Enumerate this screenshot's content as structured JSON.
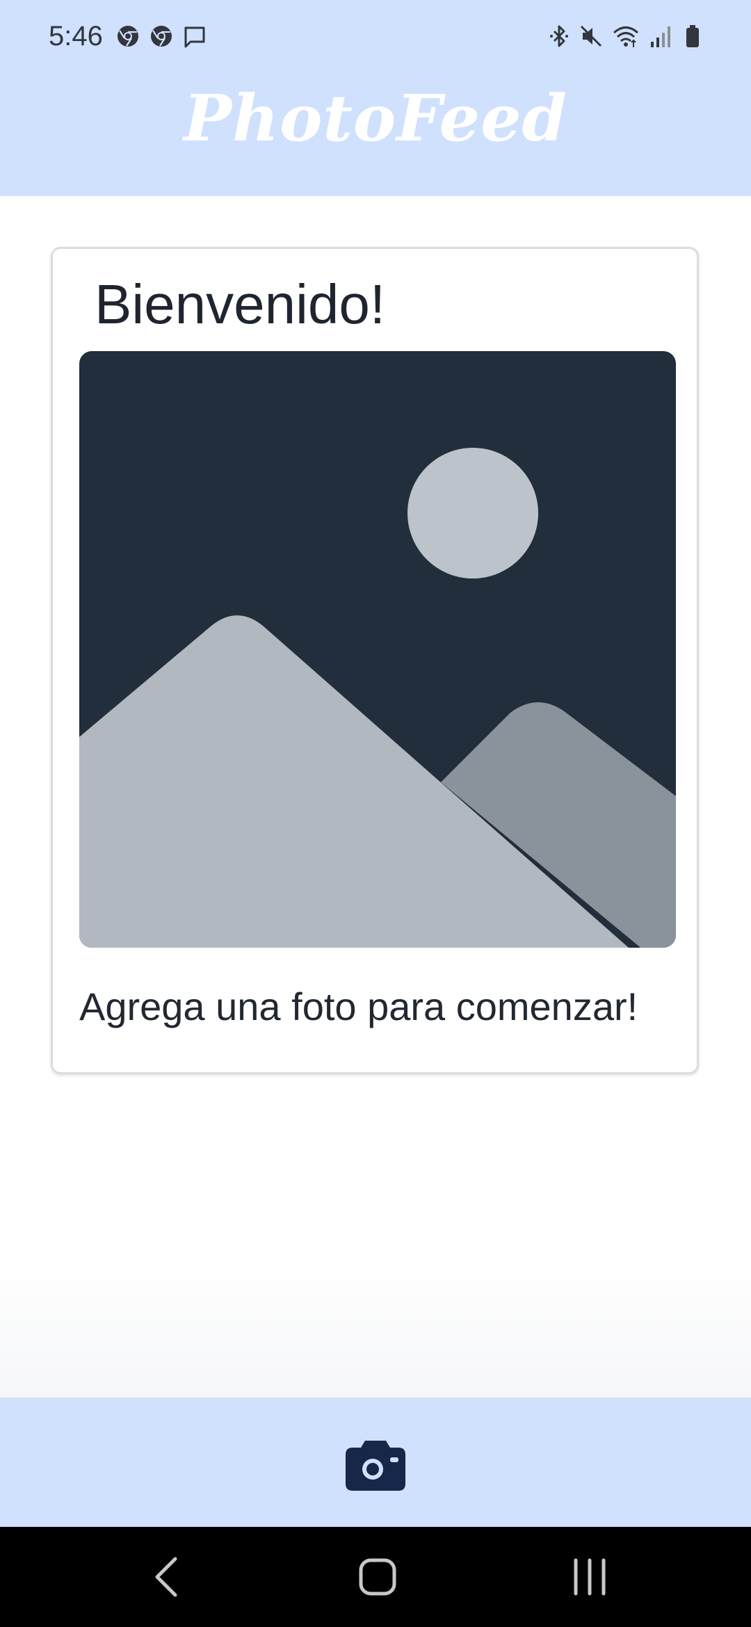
{
  "status_bar": {
    "time": "5:46",
    "left_icons": [
      "chrome-icon",
      "chrome-icon",
      "message-icon"
    ],
    "right_icons": [
      "bluetooth-icon",
      "mute-icon",
      "wifi-icon",
      "signal-icon",
      "battery-icon"
    ]
  },
  "header": {
    "title": "PhotoFeed"
  },
  "card": {
    "title": "Bienvenido!",
    "image_icon": "landscape-placeholder-icon",
    "caption": "Agrega una foto para comenzar!"
  },
  "bottom_bar": {
    "action_icon": "camera-icon"
  },
  "nav_bar": {
    "buttons": [
      "back-icon",
      "home-icon",
      "recents-icon"
    ]
  },
  "colors": {
    "header_bg": "#d0e1fd",
    "bottom_bar_bg": "#d0e1fd",
    "placeholder_bg": "#222e3b",
    "camera": "#16274a"
  }
}
